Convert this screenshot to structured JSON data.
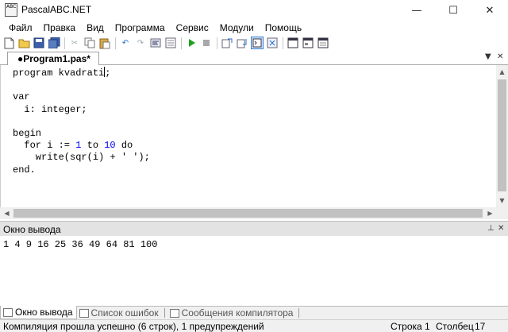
{
  "window": {
    "title": "PascalABC.NET",
    "icon_text": "ABC",
    "minimize": "—",
    "maximize": "☐",
    "close": "✕"
  },
  "menu": [
    "Файл",
    "Правка",
    "Вид",
    "Программа",
    "Сервис",
    "Модули",
    "Помощь"
  ],
  "toolbar_icons": [
    "new-file-icon",
    "open-folder-icon",
    "save-icon",
    "save-all-icon",
    "cut-icon",
    "copy-icon",
    "paste-icon",
    "undo-icon",
    "redo-icon",
    "format-code-icon",
    "properties-icon",
    "run-icon",
    "stop-icon",
    "step-over-icon",
    "step-into-icon",
    "output-window-icon",
    "debug-toggle-icon",
    "module-icon",
    "form-icon",
    "form-designer-icon"
  ],
  "tab": {
    "label": "●Program1.pas*",
    "arrow": "▼",
    "close": "✕"
  },
  "code": {
    "line1_kw": "program",
    "line1_name": "kvadrati",
    "line1_end": ";",
    "line3": "var",
    "line4_indent": "  ",
    "line4_text": "i: integer;",
    "line6": "begin",
    "line7_a": "  for i := ",
    "line7_n1": "1",
    "line7_b": " to ",
    "line7_n2": "10",
    "line7_c": " do",
    "line8": "    write(sqr(i) + ' ');",
    "line9": "end."
  },
  "output": {
    "title": "Окно вывода",
    "pin": "⊥",
    "close": "✕",
    "text": "1 4 9 16 25 36 49 64 81 100"
  },
  "bottom_tabs": [
    "Окно вывода",
    "Список ошибок",
    "Сообщения компилятора"
  ],
  "status": {
    "message": "Компиляция прошла успешно (6 строк), 1 предупреждений",
    "row_label": "Строка",
    "row_value": "1",
    "col_label": "Столбец",
    "col_value": "17"
  }
}
